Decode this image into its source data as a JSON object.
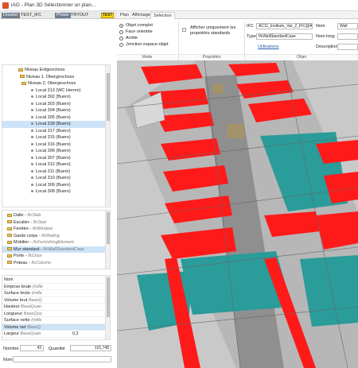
{
  "window": {
    "title": "iAO - Plan 3D Sélectionner un plan..."
  },
  "topbar": {
    "dossier_label": "Dossier",
    "dossier_value": "TEST_IFC",
    "phase_label": "Phase",
    "phase_value": "TRYOUT",
    "badge": "TEST"
  },
  "ribbon": {
    "tabs": [
      "Plan",
      "Affichage",
      "Sélection"
    ],
    "mode": {
      "options": [
        "Objet complet",
        "Face orientée",
        "Arrête",
        "Jonction espace-objet"
      ],
      "group_label": "Mode"
    },
    "proprietes": {
      "checkbox_label": "Afficher uniquement les propriétés standards",
      "group_label": "Propriétés"
    },
    "objet": {
      "ifc_label": "IFC",
      "ifc_value": "AC11_Institute_Var_2_IFC@AC",
      "type_label": "Type",
      "type_value": "IfcWallStandardCase",
      "utilisations_link": "Utilisations",
      "nom_label": "Nom",
      "nom_value": "Wall",
      "nomlong_label": "Nom long",
      "description_label": "Description",
      "group_label": "Objet"
    }
  },
  "tree": {
    "levels": [
      "Niveau Erdgeschoss",
      "Niveau 1. Obergeschoss",
      "Niveau 2. Obergeschoss"
    ],
    "locals": [
      "Local 313 (WC Herren)",
      "Local 302 (Buero)",
      "Local 303 (Buero)",
      "Local 304 (Buero)",
      "Local 305 (Buero)",
      "Local 318 (Buero)",
      "Local 317 (Buero)",
      "Local 315 (Buero)",
      "Local 316 (Buero)",
      "Local 306 (Buero)",
      "Local 307 (Buero)",
      "Local 312 (Buero)",
      "Local 311 (Buero)",
      "Local 310 (Buero)",
      "Local 309 (Buero)",
      "Local 308 (Buero)"
    ],
    "selected_local": "Local 318 (Buero)"
  },
  "categories": [
    {
      "name": "Dalle",
      "ifc": "IfcSlab"
    },
    {
      "name": "Escalier",
      "ifc": "IfcStair"
    },
    {
      "name": "Fenêtre",
      "ifc": "IfcWindow"
    },
    {
      "name": "Garde corps",
      "ifc": "IfcRailing"
    },
    {
      "name": "Mobilier",
      "ifc": "IfcFurnishingElement"
    },
    {
      "name": "Mur standard",
      "ifc": "IfcWallStandardCase"
    },
    {
      "name": "Porte",
      "ifc": "IfcDoor"
    },
    {
      "name": "Poteau",
      "ifc": "IfcColumn"
    }
  ],
  "selected_category": "Mur standard",
  "properties": [
    {
      "name": "Nom",
      "source": "",
      "value": ""
    },
    {
      "name": "Emprise brute",
      "source": "(mille",
      "value": ""
    },
    {
      "name": "Surface brute",
      "source": "(mille",
      "value": ""
    },
    {
      "name": "Volume brut",
      "source": "BaseQ",
      "value": ""
    },
    {
      "name": "Hauteur",
      "source": "BaseQuan",
      "value": ""
    },
    {
      "name": "Longueur",
      "source": "BaseQuo",
      "value": ""
    },
    {
      "name": "Surface nette",
      "source": "(mille",
      "value": ""
    },
    {
      "name": "Volume net",
      "source": "BaseQ",
      "value": ""
    },
    {
      "name": "Largeur",
      "source": "BaseQuan",
      "value": "0,2"
    }
  ],
  "selected_property": "Volume net",
  "footer": {
    "nombre_label": "Nombre",
    "nombre_value": "43",
    "quantite_label": "Quantité",
    "quantite_value": "101,748",
    "nom_label": "Nom"
  },
  "colors": {
    "accent_red": "#ff1a1a",
    "teal": "#2a9c9a",
    "selection": "#cde3f7",
    "badge": "#ffd600"
  }
}
